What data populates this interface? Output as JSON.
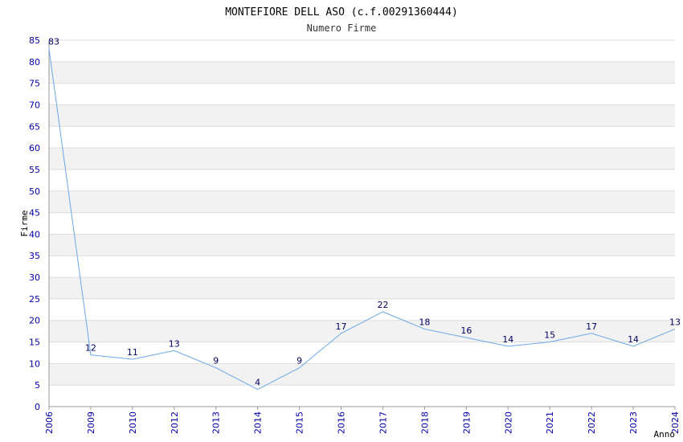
{
  "chart_data": {
    "type": "line",
    "title": "MONTEFIORE DELL ASO (c.f.00291360444)",
    "subtitle": "Numero Firme",
    "xlabel": "Anno",
    "ylabel": "Firme",
    "categories": [
      "2006",
      "2009",
      "2010",
      "2012",
      "2013",
      "2014",
      "2015",
      "2016",
      "2017",
      "2018",
      "2019",
      "2020",
      "2021",
      "2022",
      "2023",
      "2024"
    ],
    "values": [
      83,
      12,
      11,
      13,
      9,
      4,
      9,
      17,
      22,
      18,
      16,
      14,
      15,
      17,
      14,
      18
    ],
    "data_labels": [
      "83",
      "12",
      "11",
      "13",
      "9",
      "4",
      "9",
      "17",
      "22",
      "18",
      "16",
      "14",
      "15",
      "17",
      "14",
      "13"
    ],
    "ylim": [
      0,
      85
    ],
    "yticks": [
      0,
      5,
      10,
      15,
      20,
      25,
      30,
      35,
      40,
      45,
      50,
      55,
      60,
      65,
      70,
      75,
      80,
      85
    ],
    "grid": true,
    "colors": {
      "line": "#6aa8e8",
      "band": "#f2f2f2",
      "grid": "#dddddd",
      "tick_text": "#0000aa",
      "label_text": "#000066"
    }
  }
}
